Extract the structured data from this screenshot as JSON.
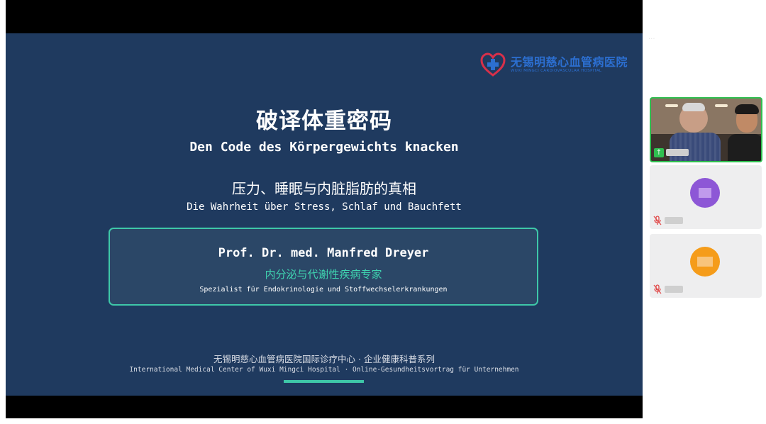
{
  "slide": {
    "logo_cn": "无锡明慈心血管病医院",
    "logo_en": "WUXI MINGCI CARDIOVASCULAR HOSPITAL",
    "title_cn": "破译体重密码",
    "title_de": "Den Code des Körpergewichts knacken",
    "subtitle_cn": "压力、睡眠与内脏脂肪的真相",
    "subtitle_de": "Die Wahrheit über Stress, Schlaf und Bauchfett",
    "speaker": {
      "name": "Prof. Dr. med. Manfred Dreyer",
      "role_cn": "内分泌与代谢性疾病专家",
      "role_de": "Spezialist für Endokrinologie und Stoffwechselerkrankungen"
    },
    "footer_cn": "无锡明慈心血管病医院国际诊疗中心 · 企业健康科普系列",
    "footer_en": "International Medical Center of Wuxi Mingci Hospital · Online-Gesundheitsvortrag für Unternehmen"
  },
  "participants": [
    {
      "state": "speaking",
      "mic": "sharing",
      "avatar_color": null
    },
    {
      "state": "idle",
      "mic": "muted",
      "avatar_color": "#8d57d6"
    },
    {
      "state": "idle",
      "mic": "muted",
      "avatar_color": "#f59c1a"
    }
  ],
  "colors": {
    "slide_bg": "#1f3a5f",
    "accent_teal": "#3ec7a8",
    "active_border": "#2fbf4f"
  }
}
